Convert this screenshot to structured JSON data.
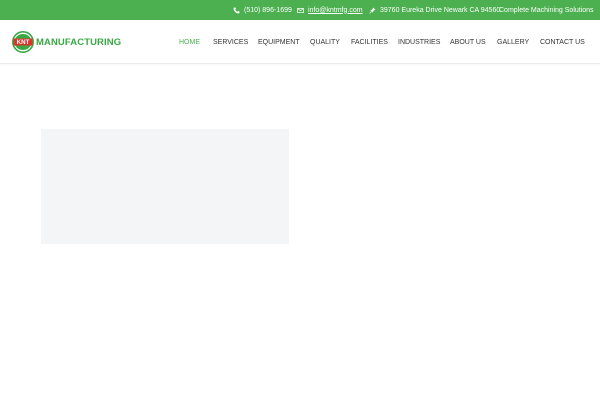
{
  "topbar": {
    "background": "#4caf50",
    "phone": "(510) 896-1699",
    "phone_icon": "phone-icon",
    "email": "info@kntmfg.com",
    "email_icon": "mail-icon",
    "address": "39760 Eureka Drive Newark CA 94560",
    "address_icon": "pin-icon",
    "tagline": "Complete Machining Solutions"
  },
  "header": {
    "logo_text": "MANUFACTURING",
    "logo_mark_text": "KNT",
    "brand_color": "#3aa845"
  },
  "nav": {
    "items": [
      {
        "label": "HOME",
        "active": true
      },
      {
        "label": "SERVICES"
      },
      {
        "label": "EQUIPMENT"
      },
      {
        "label": "QUALITY"
      },
      {
        "label": "FACILITIES"
      },
      {
        "label": "INDUSTRIES"
      },
      {
        "label": "ABOUT US"
      },
      {
        "label": "GALLERY"
      },
      {
        "label": "CONTACT US"
      }
    ],
    "active_color": "#4caf50"
  }
}
